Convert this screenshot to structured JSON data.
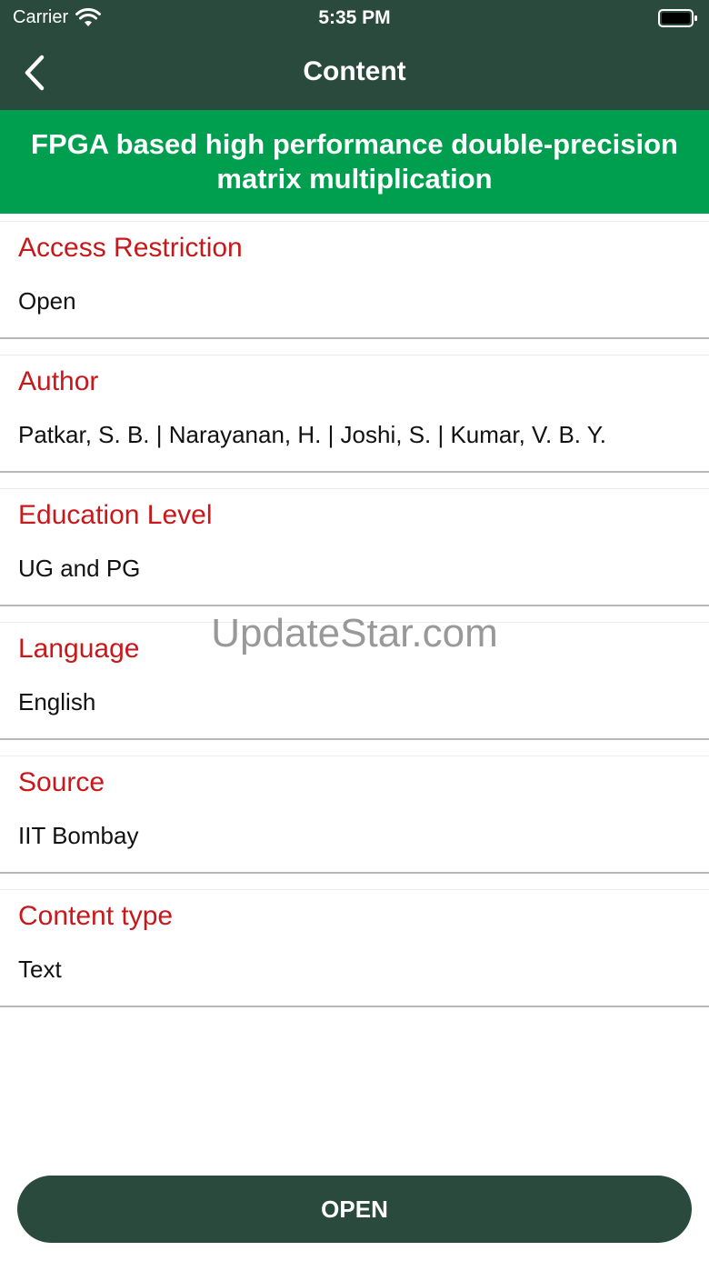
{
  "status_bar": {
    "carrier": "Carrier",
    "time": "5:35 PM"
  },
  "nav": {
    "title": "Content",
    "back_icon": "chevron-left-icon"
  },
  "banner": {
    "title": "FPGA based high performance double-precision matrix multiplication"
  },
  "details": [
    {
      "label": "Access Restriction",
      "value": "Open"
    },
    {
      "label": "Author",
      "value": "Patkar, S. B. | Narayanan, H. | Joshi, S. | Kumar, V. B. Y."
    },
    {
      "label": "Education Level",
      "value": "UG and PG"
    },
    {
      "label": "Language",
      "value": "English"
    },
    {
      "label": "Source",
      "value": "IIT Bombay"
    },
    {
      "label": "Content type",
      "value": "Text"
    }
  ],
  "watermark": "UpdateStar.com",
  "open_button": {
    "label": "OPEN"
  },
  "colors": {
    "header": "#2a4a3d",
    "banner": "#009e4f",
    "label": "#c8181b"
  }
}
